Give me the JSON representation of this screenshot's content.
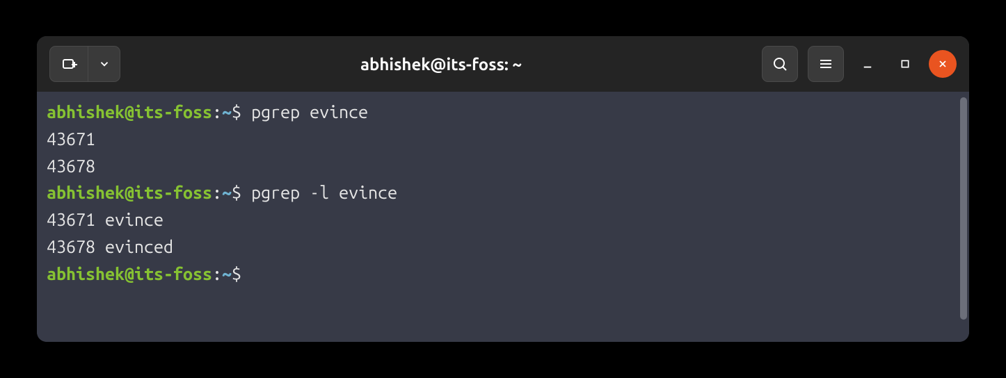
{
  "window": {
    "title": "abhishek@its-foss: ~"
  },
  "prompt": {
    "user_host": "abhishek@its-foss",
    "colon": ":",
    "path": "~",
    "symbol": "$"
  },
  "session": {
    "line1_cmd": "pgrep evince",
    "line2_out": "43671",
    "line3_out": "43678",
    "line4_cmd": "pgrep -l evince",
    "line5_out": "43671 evince",
    "line6_out": "43678 evinced",
    "line7_cmd": ""
  }
}
